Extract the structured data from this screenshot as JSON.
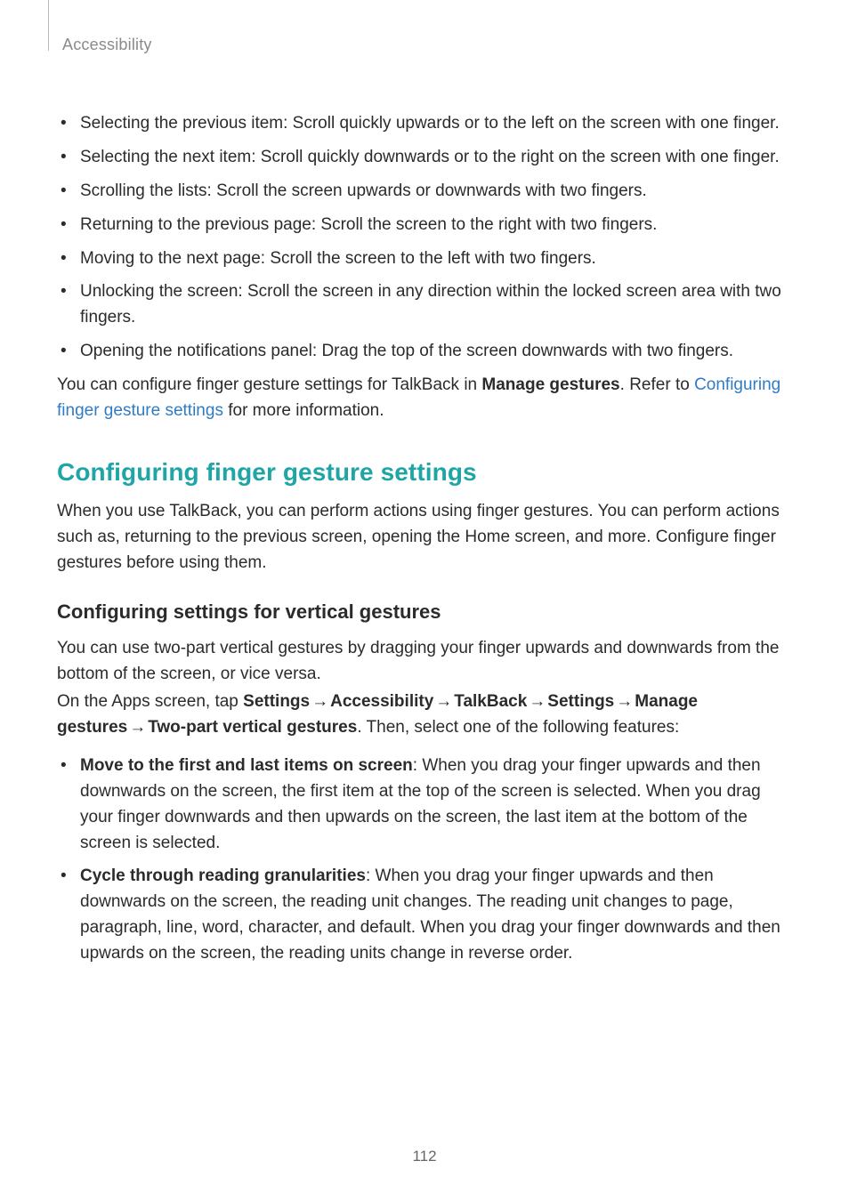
{
  "header": {
    "section": "Accessibility"
  },
  "gestures_list": [
    "Selecting the previous item: Scroll quickly upwards or to the left on the screen with one finger.",
    "Selecting the next item: Scroll quickly downwards or to the right on the screen with one finger.",
    "Scrolling the lists: Scroll the screen upwards or downwards with two fingers.",
    "Returning to the previous page: Scroll the screen to the right with two fingers.",
    "Moving to the next page: Scroll the screen to the left with two fingers.",
    "Unlocking the screen: Scroll the screen in any direction within the locked screen area with two fingers.",
    "Opening the notifications panel: Drag the top of the screen downwards with two fingers."
  ],
  "postlist": {
    "pre": "You can configure finger gesture settings for TalkBack in ",
    "bold": "Manage gestures",
    "mid": ". Refer to ",
    "link": "Configuring finger gesture settings",
    "post": " for more information."
  },
  "h2": "Configuring finger gesture settings",
  "intro_para": "When you use TalkBack, you can perform actions using finger gestures. You can perform actions such as, returning to the previous screen, opening the Home screen, and more. Configure finger gestures before using them.",
  "h3": "Configuring settings for vertical gestures",
  "vert_para1": "You can use two-part vertical gestures by dragging your finger upwards and downwards from the bottom of the screen, or vice versa.",
  "nav": {
    "lead": "On the Apps screen, tap ",
    "s1": "Settings",
    "s2": "Accessibility",
    "s3": "TalkBack",
    "s4": "Settings",
    "s5": "Manage gestures",
    "s6": "Two-part vertical gestures",
    "arrow": "→",
    "tail": ". Then, select one of the following features:"
  },
  "feature_list": [
    {
      "bold": "Move to the first and last items on screen",
      "rest": ": When you drag your finger upwards and then downwards on the screen, the first item at the top of the screen is selected. When you drag your finger downwards and then upwards on the screen, the last item at the bottom of the screen is selected."
    },
    {
      "bold": "Cycle through reading granularities",
      "rest": ": When you drag your finger upwards and then downwards on the screen, the reading unit changes. The reading unit changes to page, paragraph, line, word, character, and default. When you drag your finger downwards and then upwards on the screen, the reading units change in reverse order."
    }
  ],
  "page_number": "112"
}
